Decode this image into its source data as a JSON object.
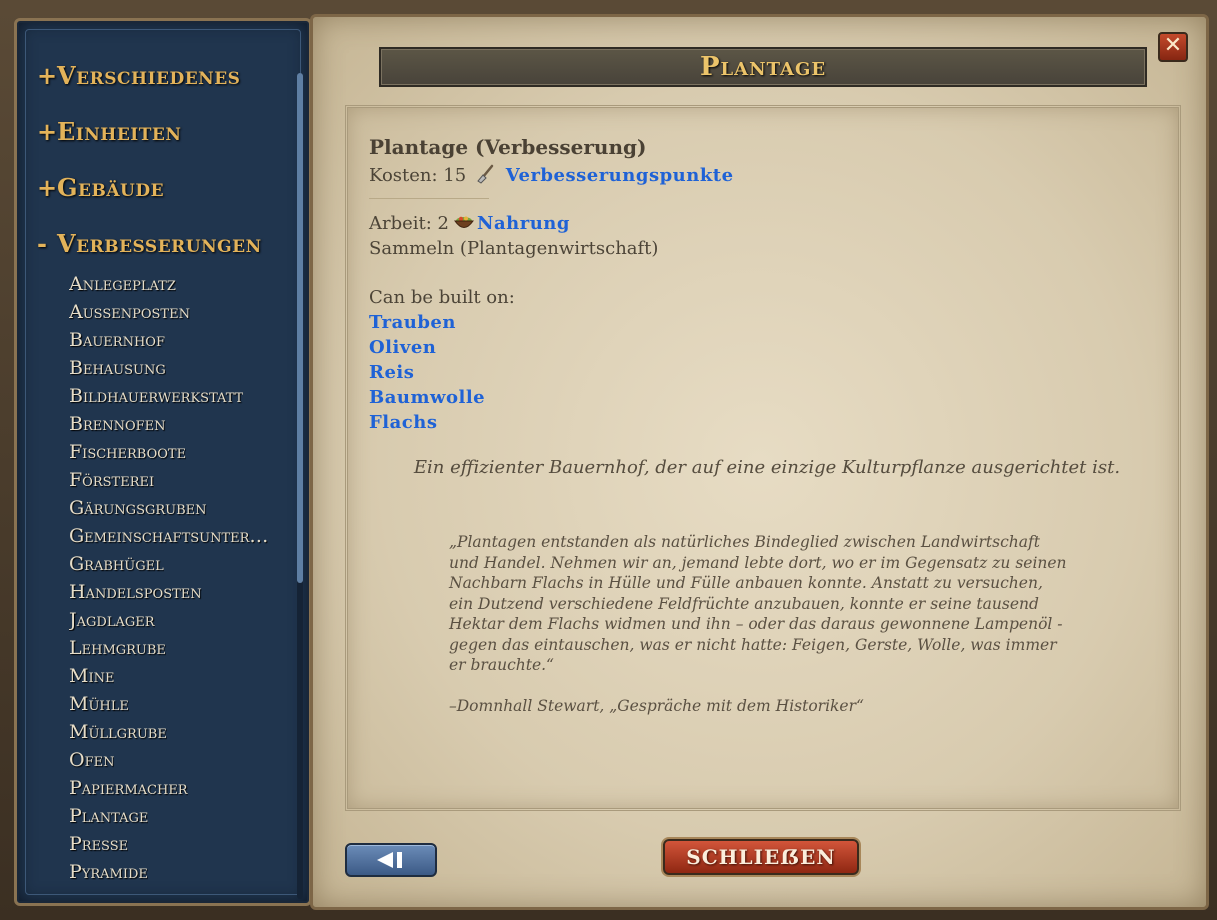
{
  "sidebar": {
    "categories": [
      {
        "sign": "+",
        "label": "Verschiedenes"
      },
      {
        "sign": "+",
        "label": "Einheiten"
      },
      {
        "sign": "+",
        "label": "Gebäude"
      },
      {
        "sign": "-",
        "label": "Verbesserungen"
      }
    ],
    "items": [
      "Anlegeplatz",
      "Außenposten",
      "Bauernhof",
      "Behausung",
      "Bildhauerwerkstatt",
      "Brennofen",
      "Fischerboote",
      "Försterei",
      "Gärungsgruben",
      "Gemeinschaftsunter…",
      "Grabhügel",
      "Handelsposten",
      "Jagdlager",
      "Lehmgrube",
      "Mine",
      "Mühle",
      "Müllgrube",
      "Ofen",
      "Papiermacher",
      "Plantage",
      "Presse",
      "Pyramide"
    ]
  },
  "panel": {
    "title": "Plantage",
    "close_x": "✕",
    "heading": "Plantage (Verbesserung)",
    "cost_label": "Kosten: 15",
    "cost_resource": "Verbesserungspunkte",
    "work_label": "Arbeit: 2",
    "work_resource": "Nahrung",
    "gather": "Sammeln (Plantagenwirtschaft)",
    "built_on_label": "Can be built on:",
    "built_on": [
      "Trauben",
      "Oliven",
      "Reis",
      "Baumwolle",
      "Flachs"
    ],
    "description": "Ein effizienter Bauernhof, der auf eine einzige Kulturpflanze ausgerichtet ist.",
    "quote": "„Plantagen entstanden als natürliches Bindeglied zwischen Landwirtschaft und Handel. Nehmen wir an, jemand lebte dort, wo er im Gegensatz zu seinen Nachbarn Flachs in Hülle und Fülle anbauen konnte. Anstatt zu versuchen, ein Dutzend verschiedene Feldfrüchte anzubauen, konnte er seine tausend Hektar dem Flachs widmen und ihn – oder das daraus gewonnene Lampenöl -gegen das eintauschen, was er nicht hatte: Feigen, Gerste, Wolle, was immer er brauchte.“",
    "attribution": "–Domnhall Stewart, „Gespräche mit dem Historiker“",
    "close_button": "SCHLIEẞEN"
  },
  "icons": {
    "cost_icon": "shovel-icon",
    "food_icon": "food-bowl-icon",
    "back_icon": "back-arrow-icon"
  }
}
